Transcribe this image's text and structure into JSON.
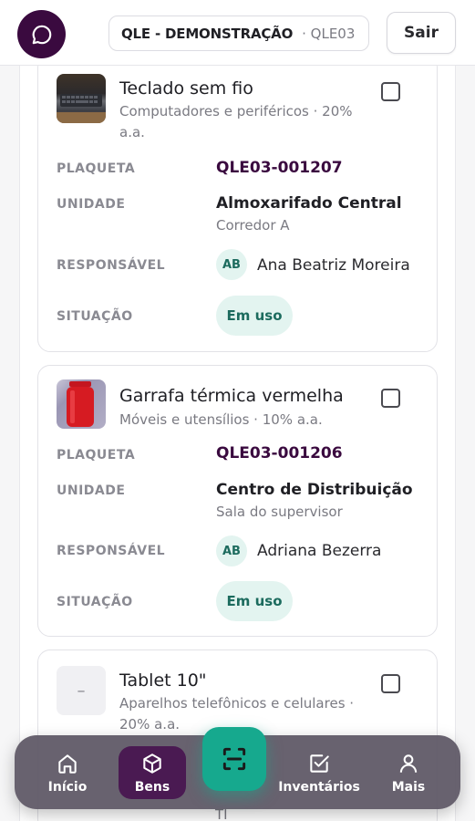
{
  "header": {
    "org_name": "QLE - DEMONSTRAÇÃO",
    "org_code": "· QLE03",
    "logout_label": "Sair"
  },
  "fields": {
    "plaqueta": "PLAQUETA",
    "unidade": "UNIDADE",
    "responsavel": "RESPONSÁVEL",
    "situacao": "SITUAÇÃO"
  },
  "items": [
    {
      "title": "Teclado sem fio",
      "subtitle": "Computadores e periféricos · 20% a.a.",
      "plaqueta": "QLE03-001207",
      "unit": "Almoxarifado Central",
      "unit_sub": "Corredor A",
      "responsible_initials": "AB",
      "responsible": "Ana Beatriz Moreira",
      "status": "Em uso",
      "thumb_icon": "keyboard-photo"
    },
    {
      "title": "Garrafa térmica vermelha",
      "subtitle": "Móveis e utensílios · 10% a.a.",
      "plaqueta": "QLE03-001206",
      "unit": "Centro de Distribuição",
      "unit_sub": "Sala do supervisor",
      "responsible_initials": "AB",
      "responsible": "Adriana Bezerra",
      "status": "Em uso",
      "thumb_icon": "bottle-photo"
    },
    {
      "title": "Tablet 10\"",
      "subtitle": "Aparelhos telefônicos e celulares · 20% a.a.",
      "thumb_placeholder": "–",
      "peek_text": "TI"
    }
  ],
  "nav": {
    "home": "Início",
    "assets": "Bens",
    "inventories": "Inventários",
    "more": "Mais",
    "active": "assets"
  },
  "colors": {
    "brand": "#3a0a3f",
    "accent": "#16a98e",
    "badge_bg": "#e3f4f0",
    "badge_text": "#1c6b5e"
  }
}
